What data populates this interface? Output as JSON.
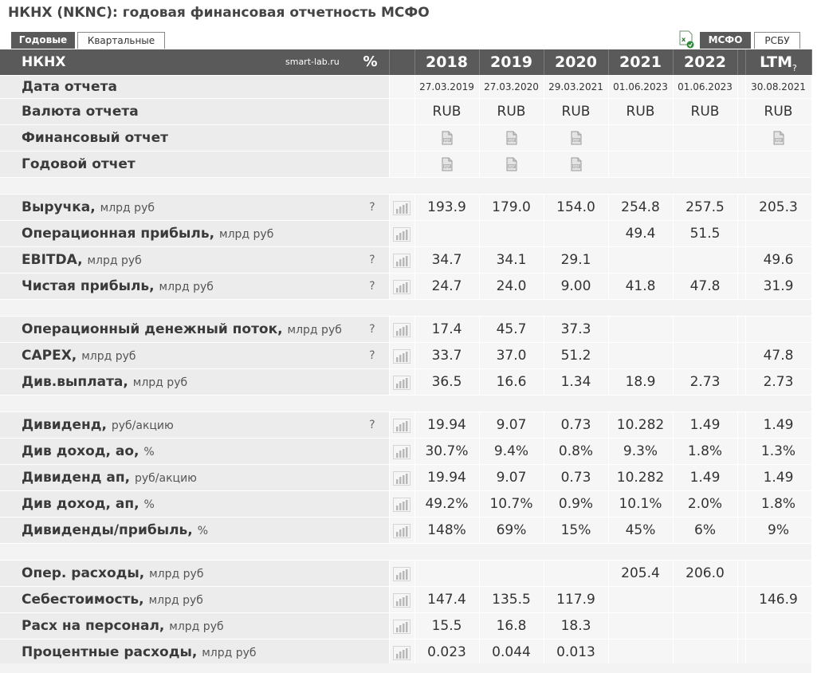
{
  "page": {
    "title": "НКНХ (NKNC): годовая финансовая отчетность МСФО"
  },
  "tabs": {
    "annual": "Годовые",
    "quarterly": "Квартальные",
    "msfo": "МСФО",
    "rsbu": "РСБУ"
  },
  "header": {
    "name": "НКНХ",
    "source": "smart-lab.ru",
    "pct": "%",
    "years": [
      "2018",
      "2019",
      "2020",
      "2021",
      "2022"
    ],
    "ltm": "LTM",
    "ltm_q": "?"
  },
  "info_rows": [
    {
      "label": "Дата отчета",
      "type": "date",
      "values": [
        "27.03.2019",
        "27.03.2020",
        "29.03.2021",
        "01.06.2023",
        "01.06.2023"
      ],
      "ltm": "30.08.2021"
    },
    {
      "label": "Валюта отчета",
      "type": "text",
      "values": [
        "RUB",
        "RUB",
        "RUB",
        "RUB",
        "RUB"
      ],
      "ltm": "RUB"
    },
    {
      "label": "Финансовый отчет",
      "type": "pdf",
      "pdf": [
        true,
        true,
        true,
        false,
        false
      ],
      "ltm_pdf": true
    },
    {
      "label": "Годовой отчет",
      "type": "pdf",
      "pdf": [
        true,
        true,
        true,
        false,
        false
      ],
      "ltm_pdf": false
    }
  ],
  "groups": [
    [
      {
        "label": "Выручка,",
        "unit": "млрд руб",
        "q": "?",
        "values": [
          "193.9",
          "179.0",
          "154.0",
          "254.8",
          "257.5"
        ],
        "ltm": "205.3"
      },
      {
        "label": "Операционная прибыль,",
        "unit": "млрд руб",
        "q": "",
        "values": [
          "",
          "",
          "",
          "49.4",
          "51.5"
        ],
        "ltm": ""
      },
      {
        "label": "EBITDA,",
        "unit": "млрд руб",
        "q": "?",
        "values": [
          "34.7",
          "34.1",
          "29.1",
          "",
          ""
        ],
        "ltm": "49.6"
      },
      {
        "label": "Чистая прибыль,",
        "unit": "млрд руб",
        "q": "?",
        "values": [
          "24.7",
          "24.0",
          "9.00",
          "41.8",
          "47.8"
        ],
        "ltm": "31.9"
      }
    ],
    [
      {
        "label": "Операционный денежный поток,",
        "unit": "млрд руб",
        "q": "?",
        "values": [
          "17.4",
          "45.7",
          "37.3",
          "",
          ""
        ],
        "ltm": ""
      },
      {
        "label": "CAPEX,",
        "unit": "млрд руб",
        "q": "?",
        "values": [
          "33.7",
          "37.0",
          "51.2",
          "",
          ""
        ],
        "ltm": "47.8"
      },
      {
        "label": "Див.выплата,",
        "unit": "млрд руб",
        "q": "",
        "values": [
          "36.5",
          "16.6",
          "1.34",
          "18.9",
          "2.73"
        ],
        "ltm": "2.73"
      }
    ],
    [
      {
        "label": "Дивиденд,",
        "unit": "руб/акцию",
        "q": "?",
        "values": [
          "19.94",
          "9.07",
          "0.73",
          "10.282",
          "1.49"
        ],
        "ltm": "1.49"
      },
      {
        "label": "Див доход, ао,",
        "unit": "%",
        "q": "",
        "values": [
          "30.7%",
          "9.4%",
          "0.8%",
          "9.3%",
          "1.8%"
        ],
        "ltm": "1.3%"
      },
      {
        "label": "Дивиденд ап,",
        "unit": "руб/акцию",
        "q": "",
        "values": [
          "19.94",
          "9.07",
          "0.73",
          "10.282",
          "1.49"
        ],
        "ltm": "1.49"
      },
      {
        "label": "Див доход, ап,",
        "unit": "%",
        "q": "",
        "values": [
          "49.2%",
          "10.7%",
          "0.9%",
          "10.1%",
          "2.0%"
        ],
        "ltm": "1.8%"
      },
      {
        "label": "Дивиденды/прибыль,",
        "unit": "%",
        "q": "",
        "values": [
          "148%",
          "69%",
          "15%",
          "45%",
          "6%"
        ],
        "ltm": "9%"
      }
    ],
    [
      {
        "label": "Опер. расходы,",
        "unit": "млрд руб",
        "q": "",
        "values": [
          "",
          "",
          "",
          "205.4",
          "206.0"
        ],
        "ltm": ""
      },
      {
        "label": "Себестоимость,",
        "unit": "млрд руб",
        "q": "",
        "values": [
          "147.4",
          "135.5",
          "117.9",
          "",
          ""
        ],
        "ltm": "146.9"
      },
      {
        "label": "Расх на персонал,",
        "unit": "млрд руб",
        "q": "",
        "values": [
          "15.5",
          "16.8",
          "18.3",
          "",
          ""
        ],
        "ltm": ""
      },
      {
        "label": "Процентные расходы,",
        "unit": "млрд руб",
        "q": "",
        "values": [
          "0.023",
          "0.044",
          "0.013",
          "",
          ""
        ],
        "ltm": ""
      }
    ]
  ]
}
